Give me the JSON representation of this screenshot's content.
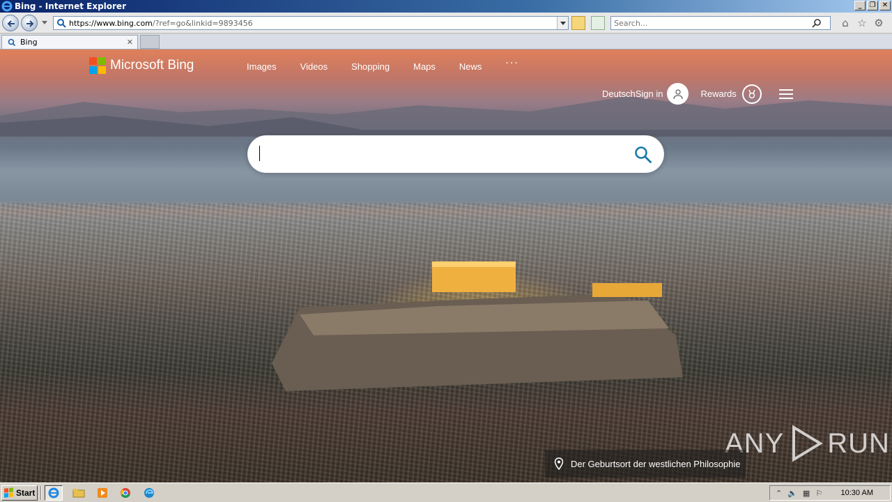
{
  "window": {
    "title": "Bing - Internet Explorer",
    "controls": [
      "_",
      "❐",
      "✕"
    ]
  },
  "navbar": {
    "url_host": "https://www.bing.com",
    "url_rest": "/?ref=go&linkid=9893456",
    "search_placeholder": "Search..."
  },
  "tabs": [
    {
      "label": "Bing",
      "close": "✕"
    }
  ],
  "bing": {
    "brand": "Microsoft Bing",
    "nav": [
      "Images",
      "Videos",
      "Shopping",
      "Maps",
      "News"
    ],
    "more": "···",
    "language": "Deutsch",
    "signin": "Sign in",
    "rewards": "Rewards",
    "search_value": "",
    "image_caption": "Der Geburtsort der westlichen Philosophie"
  },
  "watermark": {
    "left": "ANY",
    "right": "RUN"
  },
  "taskbar": {
    "start": "Start",
    "clock": "10:30 AM"
  },
  "colors": {
    "ms_red": "#f25022",
    "ms_green": "#7fba00",
    "ms_blue": "#00a4ef",
    "ms_yellow": "#ffb900",
    "search_icon": "#177ba8"
  }
}
